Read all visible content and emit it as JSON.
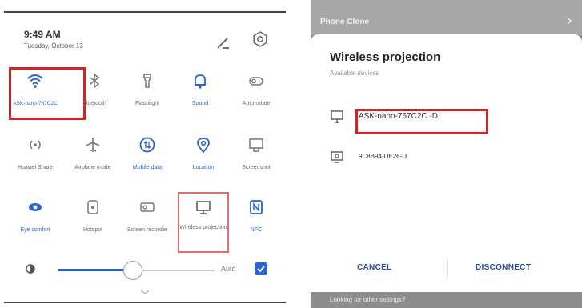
{
  "quick_settings": {
    "time": "9:49 AM",
    "date": "Tuesday, October 13",
    "tiles": [
      {
        "label": "ASK-nano-767C2C",
        "icon": "wifi-icon",
        "active": true
      },
      {
        "label": "Bluetooth",
        "icon": "bluetooth-icon",
        "active": false
      },
      {
        "label": "Flashlight",
        "icon": "flashlight-icon",
        "active": false
      },
      {
        "label": "Sound",
        "icon": "bell-icon",
        "active": true
      },
      {
        "label": "Auto-rotate",
        "icon": "auto-rotate-icon",
        "active": false
      },
      {
        "label": "Huawei Share",
        "icon": "huawei-share-icon",
        "active": false
      },
      {
        "label": "Airplane mode",
        "icon": "airplane-icon",
        "active": false
      },
      {
        "label": "Mobile data",
        "icon": "mobile-data-icon",
        "active": true
      },
      {
        "label": "Location",
        "icon": "location-icon",
        "active": true
      },
      {
        "label": "Screenshot",
        "icon": "screenshot-icon",
        "active": false
      },
      {
        "label": "Eye comfort",
        "icon": "eye-comfort-icon",
        "active": true
      },
      {
        "label": "Hotspot",
        "icon": "hotspot-icon",
        "active": false
      },
      {
        "label": "Screen recorder",
        "icon": "screen-recorder-icon",
        "active": false
      },
      {
        "label": "Wireless projection",
        "icon": "wireless-projection-icon",
        "active": false
      },
      {
        "label": "NFC",
        "icon": "nfc-icon",
        "active": true
      }
    ],
    "brightness": {
      "level": 0.48,
      "auto_label": "Auto",
      "auto_checked": true
    }
  },
  "dialog": {
    "header_title": "Phone Clone",
    "title": "Wireless projection",
    "subtitle": "Available devices",
    "devices": [
      {
        "name": "ASK-nano-767C2C -D",
        "icon": "monitor-icon"
      },
      {
        "name": "9C8B94-DE26-D",
        "icon": "tv-icon"
      }
    ],
    "cancel_label": "CANCEL",
    "disconnect_label": "DISCONNECT",
    "footer_text": "Looking for other settings?"
  },
  "colors": {
    "accent": "#2a63d4",
    "highlight": "#d22424"
  }
}
